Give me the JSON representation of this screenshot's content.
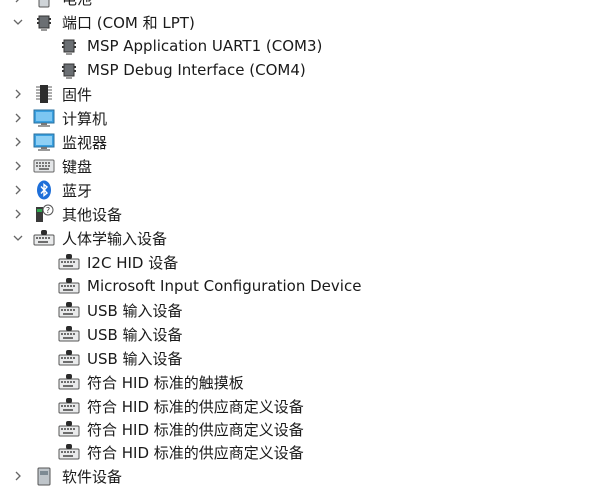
{
  "tree": {
    "battery": {
      "label": "电池",
      "icon": "battery-icon"
    },
    "ports": {
      "label": "端口 (COM 和 LPT)",
      "icon": "port-icon",
      "expanded": true,
      "children": [
        {
          "label": "MSP Application UART1 (COM3)",
          "icon": "port-icon"
        },
        {
          "label": "MSP Debug Interface (COM4)",
          "icon": "port-icon"
        }
      ]
    },
    "firmware": {
      "label": "固件",
      "icon": "firmware-chip-icon"
    },
    "computer": {
      "label": "计算机",
      "icon": "computer-monitor-icon"
    },
    "monitors": {
      "label": "监视器",
      "icon": "monitor-icon"
    },
    "keyboards": {
      "label": "键盘",
      "icon": "keyboard-icon"
    },
    "bluetooth": {
      "label": "蓝牙",
      "icon": "bluetooth-icon"
    },
    "other_devices": {
      "label": "其他设备",
      "icon": "unknown-device-icon"
    },
    "hid": {
      "label": "人体学输入设备",
      "icon": "hid-icon",
      "expanded": true,
      "children": [
        {
          "label": "I2C HID 设备",
          "icon": "hid-icon"
        },
        {
          "label": "Microsoft Input Configuration Device",
          "icon": "hid-icon"
        },
        {
          "label": "USB 输入设备",
          "icon": "hid-icon"
        },
        {
          "label": "USB 输入设备",
          "icon": "hid-icon"
        },
        {
          "label": "USB 输入设备",
          "icon": "hid-icon"
        },
        {
          "label": "符合 HID 标准的触摸板",
          "icon": "hid-icon"
        },
        {
          "label": "符合 HID 标准的供应商定义设备",
          "icon": "hid-icon"
        },
        {
          "label": "符合 HID 标准的供应商定义设备",
          "icon": "hid-icon"
        },
        {
          "label": "符合 HID 标准的供应商定义设备",
          "icon": "hid-icon"
        }
      ]
    },
    "software_devices": {
      "label": "软件设备",
      "icon": "software-device-icon"
    }
  },
  "chevrons": {
    "collapsed": "›",
    "expanded": "⌄"
  }
}
